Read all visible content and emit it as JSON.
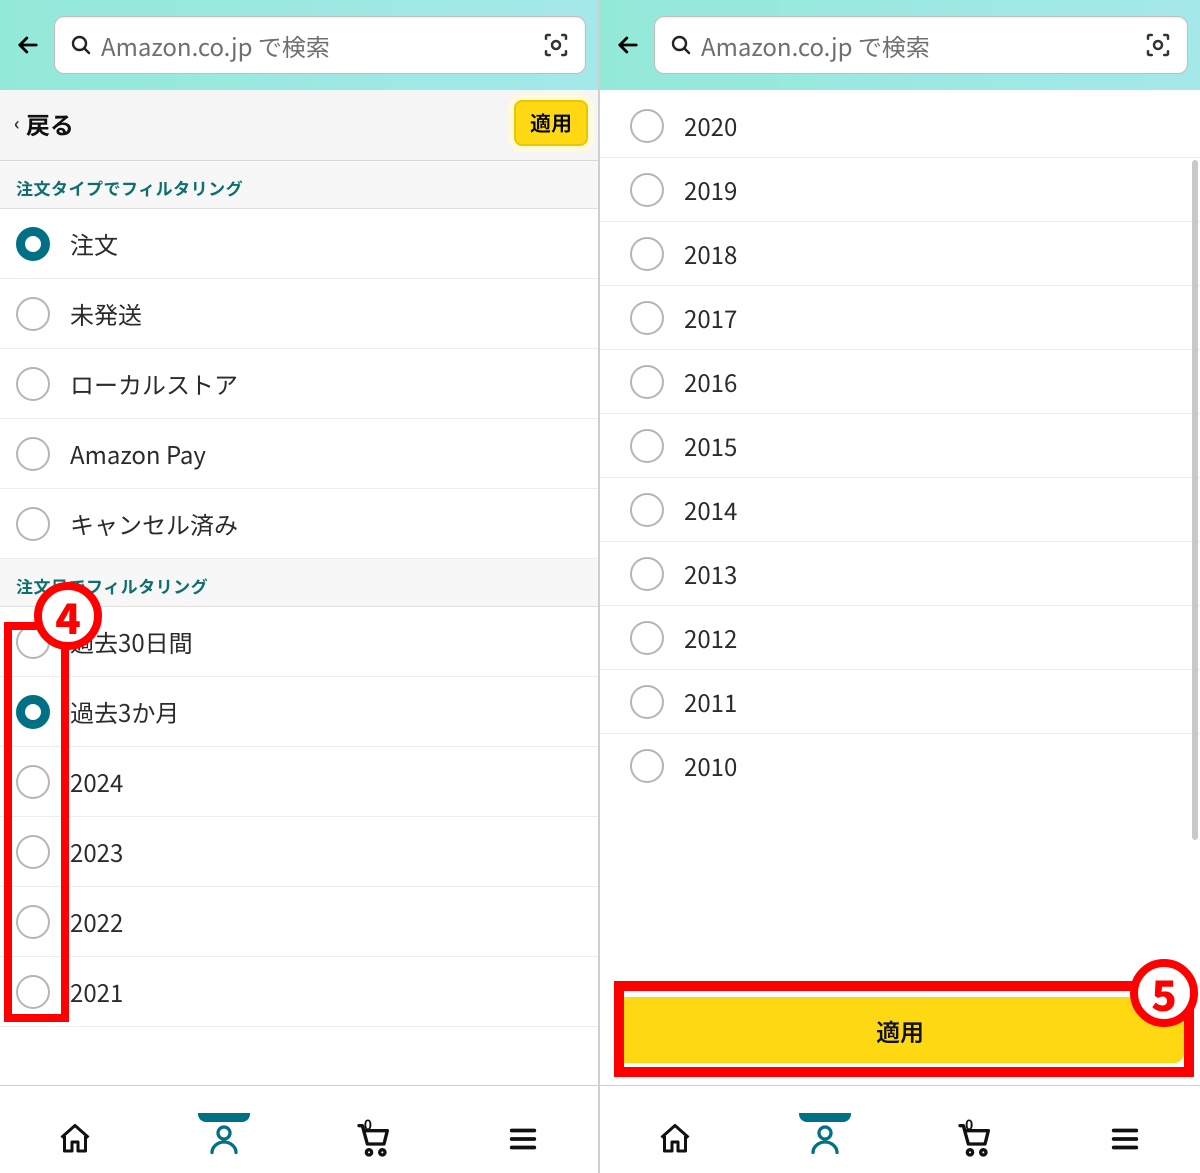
{
  "search": {
    "placeholder": "Amazon.co.jp で検索"
  },
  "subheader": {
    "back_label": "戻る",
    "apply_label": "適用"
  },
  "sections": {
    "order_type_title": "注文タイプでフィルタリング",
    "order_date_title": "注文日でフィルタリング"
  },
  "left": {
    "order_types": [
      {
        "label": "注文",
        "selected": true
      },
      {
        "label": "未発送",
        "selected": false
      },
      {
        "label": "ローカルストア",
        "selected": false
      },
      {
        "label": "Amazon Pay",
        "selected": false
      },
      {
        "label": "キャンセル済み",
        "selected": false
      }
    ],
    "date_filters": [
      {
        "label": "過去30日間",
        "selected": false
      },
      {
        "label": "過去3か月",
        "selected": true
      },
      {
        "label": "2024",
        "selected": false
      },
      {
        "label": "2023",
        "selected": false
      },
      {
        "label": "2022",
        "selected": false
      },
      {
        "label": "2021",
        "selected": false
      }
    ]
  },
  "right": {
    "years": [
      {
        "label": "2020"
      },
      {
        "label": "2019"
      },
      {
        "label": "2018"
      },
      {
        "label": "2017"
      },
      {
        "label": "2016"
      },
      {
        "label": "2015"
      },
      {
        "label": "2014"
      },
      {
        "label": "2013"
      },
      {
        "label": "2012"
      },
      {
        "label": "2011"
      },
      {
        "label": "2010"
      }
    ],
    "apply_label": "適用"
  },
  "nav": {
    "cart_count": "0"
  },
  "annotations": {
    "step4": "4",
    "step5": "5"
  }
}
